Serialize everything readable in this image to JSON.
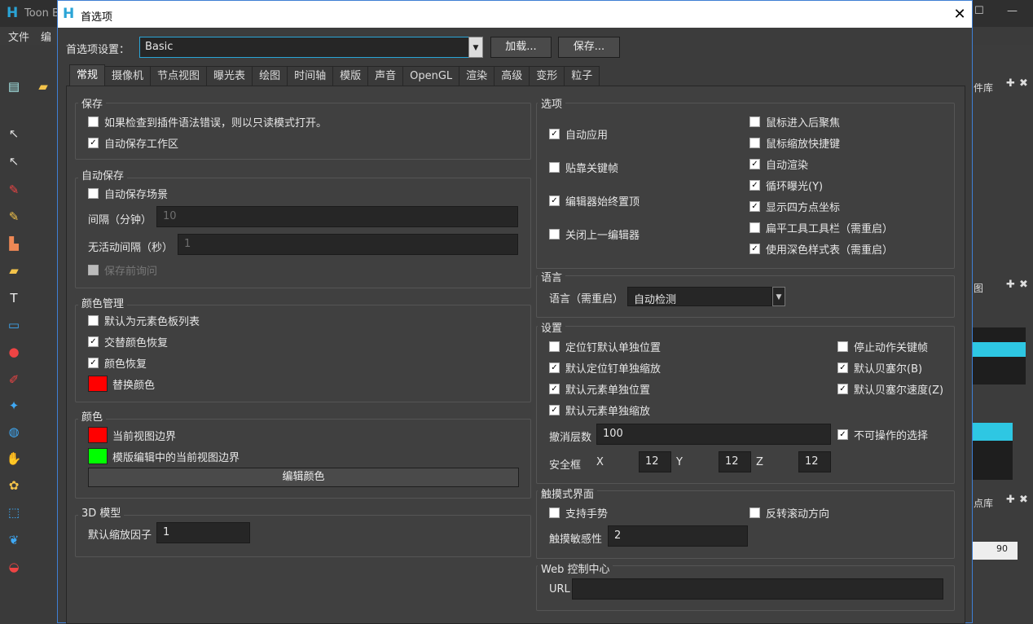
{
  "background_app": {
    "title": "Toon B",
    "menu": [
      "文件",
      "编"
    ],
    "right_panels": [
      "件库",
      "图",
      "点库"
    ],
    "timeline_value": "90"
  },
  "dialog": {
    "title": "首选项",
    "preset_label": "首选项设置：",
    "preset_value": "Basic",
    "load_btn": "加载...",
    "save_btn": "保存...",
    "tabs": [
      "常规",
      "摄像机",
      "节点视图",
      "曝光表",
      "绘图",
      "时间轴",
      "模版",
      "声音",
      "OpenGL",
      "渲染",
      "高级",
      "变形",
      "粒子"
    ],
    "active_tab": "常规"
  },
  "save_group": {
    "title": "保存",
    "items": [
      {
        "label": "如果检查到插件语法错误，则以只读模式打开。",
        "checked": false
      },
      {
        "label": "自动保存工作区",
        "checked": true
      }
    ]
  },
  "autosave_group": {
    "title": "自动保存",
    "autosave_scene": {
      "label": "自动保存场景",
      "checked": false
    },
    "interval_label": "间隔（分钟）",
    "interval_value": "10",
    "idle_label": "无活动间隔（秒）",
    "idle_value": "1",
    "ask_before": {
      "label": "保存前询问",
      "checked": false
    }
  },
  "color_mgmt_group": {
    "title": "颜色管理",
    "items": [
      {
        "label": "默认为元素色板列表",
        "checked": false
      },
      {
        "label": "交替颜色恢复",
        "checked": true
      },
      {
        "label": "颜色恢复",
        "checked": true
      }
    ],
    "replace_label": "替换颜色",
    "replace_color": "#ff0000"
  },
  "color_group": {
    "title": "颜色",
    "current_border_label": "当前视图边界",
    "current_border_color": "#ff0000",
    "template_border_label": "模版编辑中的当前视图边界",
    "template_border_color": "#00ff00",
    "edit_btn": "编辑颜色"
  },
  "model3d_group": {
    "title": "3D 模型",
    "scale_label": "默认缩放因子",
    "scale_value": "1"
  },
  "options_group": {
    "title": "选项",
    "left": [
      {
        "label": "自动应用",
        "checked": true
      },
      {
        "label": "贴靠关键帧",
        "checked": false
      },
      {
        "label": "编辑器始终置顶",
        "checked": true
      },
      {
        "label": "关闭上一编辑器",
        "checked": false
      }
    ],
    "right": [
      {
        "label": "鼠标进入后聚焦",
        "checked": false
      },
      {
        "label": "鼠标缩放快捷键",
        "checked": false
      },
      {
        "label": "自动渲染",
        "checked": true
      },
      {
        "label": "循环曝光(Y)",
        "checked": true
      },
      {
        "label": "显示四方点坐标",
        "checked": true
      },
      {
        "label": "扁平工具工具栏（需重启）",
        "checked": false
      },
      {
        "label": "使用深色样式表（需重启）",
        "checked": true
      }
    ]
  },
  "language_group": {
    "title": "语言",
    "label": "语言（需重启）",
    "value": "自动检测"
  },
  "settings_group": {
    "title": "设置",
    "left": [
      {
        "label": "定位钉默认单独位置",
        "checked": false
      },
      {
        "label": "默认定位钉单独缩放",
        "checked": true
      },
      {
        "label": "默认元素单独位置",
        "checked": true
      },
      {
        "label": "默认元素单独缩放",
        "checked": true
      }
    ],
    "right": [
      {
        "label": "停止动作关键帧",
        "checked": false
      },
      {
        "label": "默认贝塞尔(B)",
        "checked": true
      },
      {
        "label": "默认贝塞尔速度(Z)",
        "checked": true
      }
    ],
    "undo_label": "撤消层数",
    "undo_value": "100",
    "non_operable": {
      "label": "不可操作的选择",
      "checked": true
    },
    "safe_label": "安全框",
    "x_label": "X",
    "x_value": "12",
    "y_label": "Y",
    "y_value": "12",
    "z_label": "Z",
    "z_value": "12"
  },
  "touch_group": {
    "title": "触摸式界面",
    "gesture": {
      "label": "支持手势",
      "checked": false
    },
    "reverse": {
      "label": "反转滚动方向",
      "checked": false
    },
    "sensitivity_label": "触摸敏感性",
    "sensitivity_value": "2"
  },
  "web_group": {
    "title": "Web 控制中心",
    "url_label": "URL",
    "url_value": ""
  }
}
